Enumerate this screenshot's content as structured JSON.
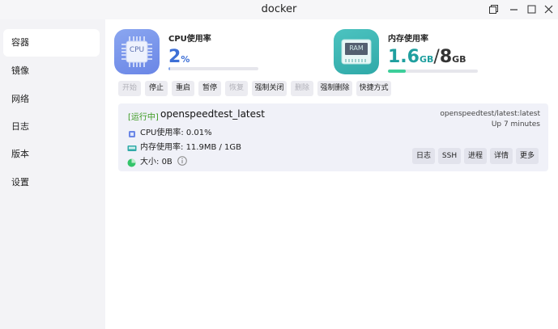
{
  "window": {
    "title": "docker"
  },
  "titlebar_icons": [
    "restore-icon",
    "minimize-icon",
    "maximize-icon",
    "close-icon"
  ],
  "sidebar": {
    "items": [
      {
        "label": "容器",
        "active": true
      },
      {
        "label": "镜像"
      },
      {
        "label": "网络"
      },
      {
        "label": "日志"
      },
      {
        "label": "版本"
      },
      {
        "label": "设置"
      }
    ]
  },
  "stats": {
    "cpu": {
      "label": "CPU使用率",
      "value": "2",
      "unit": "%",
      "chip_text": "CPU",
      "fraction": 0.02,
      "color": "#3d6fd6"
    },
    "mem": {
      "label": "内存使用率",
      "used": "1.6",
      "used_unit": "GB",
      "sep": "/",
      "total": "8",
      "total_unit": "GB",
      "chip_text": "RAM",
      "fraction": 0.2,
      "color": "#1f9f9f"
    }
  },
  "actions": [
    {
      "label": "开始",
      "enabled": false
    },
    {
      "label": "停止",
      "enabled": true
    },
    {
      "label": "重启",
      "enabled": true
    },
    {
      "label": "暂停",
      "enabled": true
    },
    {
      "label": "恢复",
      "enabled": false
    },
    {
      "label": "强制关闭",
      "enabled": true
    },
    {
      "label": "删除",
      "enabled": false
    },
    {
      "label": "强制删除",
      "enabled": true
    },
    {
      "label": "快捷方式",
      "enabled": true
    }
  ],
  "container": {
    "status": "[运行中]",
    "name": "openspeedtest_latest",
    "image": "openspeedtest/latest:latest",
    "uptime": "Up 7 minutes",
    "cpu_label": "CPU使用率:",
    "cpu_value": "0.01%",
    "mem_label": "内存使用率:",
    "mem_value": "11.9MB / 1GB",
    "size_label": "大小:",
    "size_value": "0B",
    "buttons": [
      "日志",
      "SSH",
      "进程",
      "详情",
      "更多"
    ]
  },
  "colors": {
    "status_running": "#3a9a1f",
    "mem_bar": "#3ccf9a",
    "cpu_bar": "#7fa3ea"
  }
}
